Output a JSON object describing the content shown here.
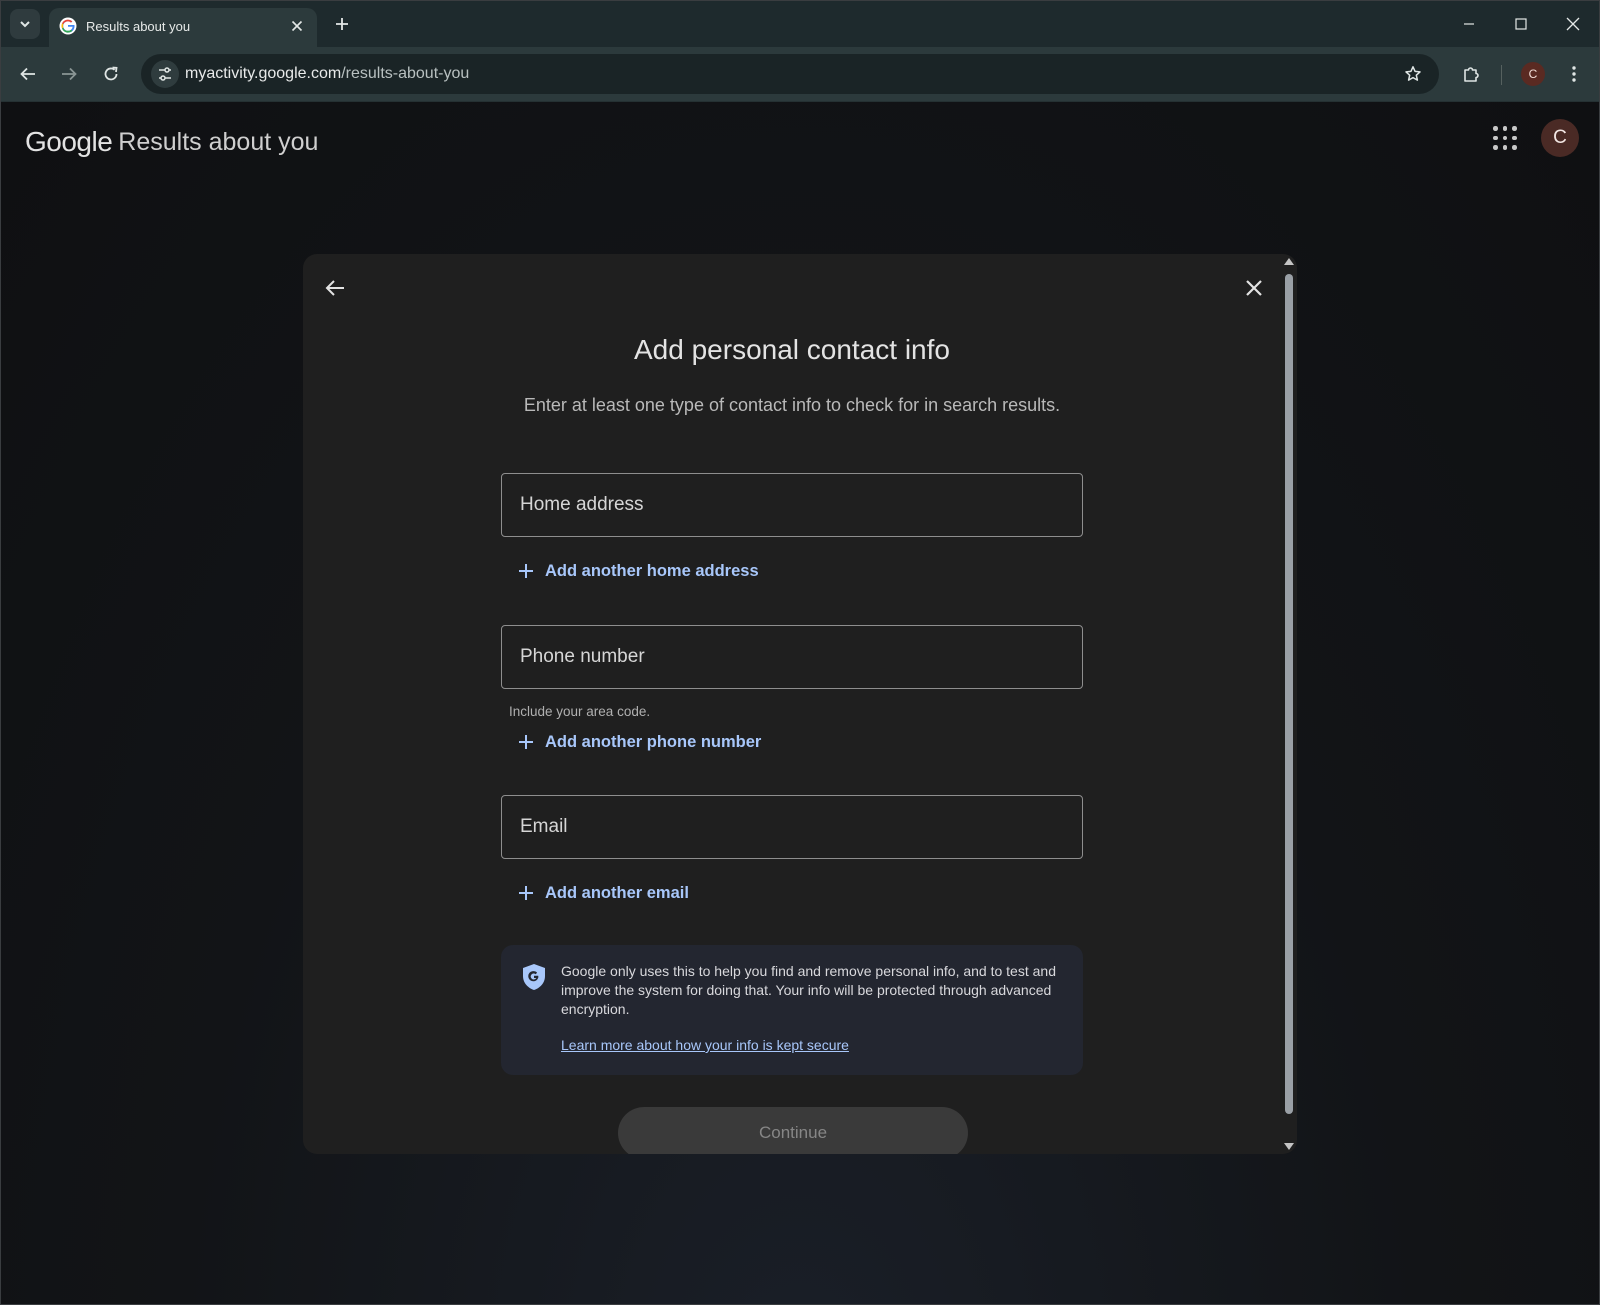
{
  "browser": {
    "tab_title": "Results about you",
    "url_host": "myactivity.google.com",
    "url_path": "/results-about-you",
    "profile_initial": "C"
  },
  "header": {
    "logo": "Google",
    "title": "Results about you",
    "account_initial": "C"
  },
  "dialog": {
    "title": "Add personal contact info",
    "subtitle": "Enter at least one type of contact info to check for in search results.",
    "home_address_placeholder": "Home address",
    "add_home_address": "Add another home address",
    "phone_placeholder": "Phone number",
    "phone_helper": "Include your area code.",
    "add_phone": "Add another phone number",
    "email_placeholder": "Email",
    "add_email": "Add another email",
    "notice_text": "Google only uses this to help you find and remove personal info, and to test and improve the system for doing that. Your info will be protected through advanced encryption.",
    "notice_link": "Learn more about how your info is kept secure",
    "continue_label": "Continue"
  },
  "icons": {
    "tab_search": "chevron-down-icon",
    "favicon": "google-g-icon",
    "tab_close": "close-icon",
    "new_tab": "plus-icon",
    "back": "arrow-left-icon",
    "forward": "arrow-right-icon",
    "reload": "reload-icon",
    "site_info": "tune-icon",
    "bookmark": "star-icon",
    "extensions": "puzzle-icon",
    "menu": "more-vert-icon",
    "apps": "apps-grid-icon",
    "shield": "shield-g-icon"
  },
  "colors": {
    "link": "#a8c7fa",
    "dialog_bg": "#1f1f1f",
    "chrome_frame": "#2c3a3c"
  }
}
